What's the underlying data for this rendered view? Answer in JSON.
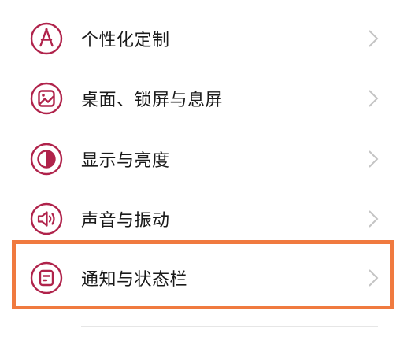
{
  "settings": {
    "items": [
      {
        "label": "个性化定制",
        "icon": "personalization-icon"
      },
      {
        "label": "桌面、锁屏与息屏",
        "icon": "wallpaper-icon"
      },
      {
        "label": "显示与亮度",
        "icon": "display-brightness-icon"
      },
      {
        "label": "声音与振动",
        "icon": "speaker-icon"
      },
      {
        "label": "通知与状态栏",
        "icon": "notification-statusbar-icon"
      }
    ],
    "highlighted_item": "通知与状态栏"
  },
  "colors": {
    "icon_accent": "#b0234b",
    "highlight_border": "#f07a3f",
    "chevron": "#c4c4c4",
    "label_text": "#1a1a1a"
  }
}
